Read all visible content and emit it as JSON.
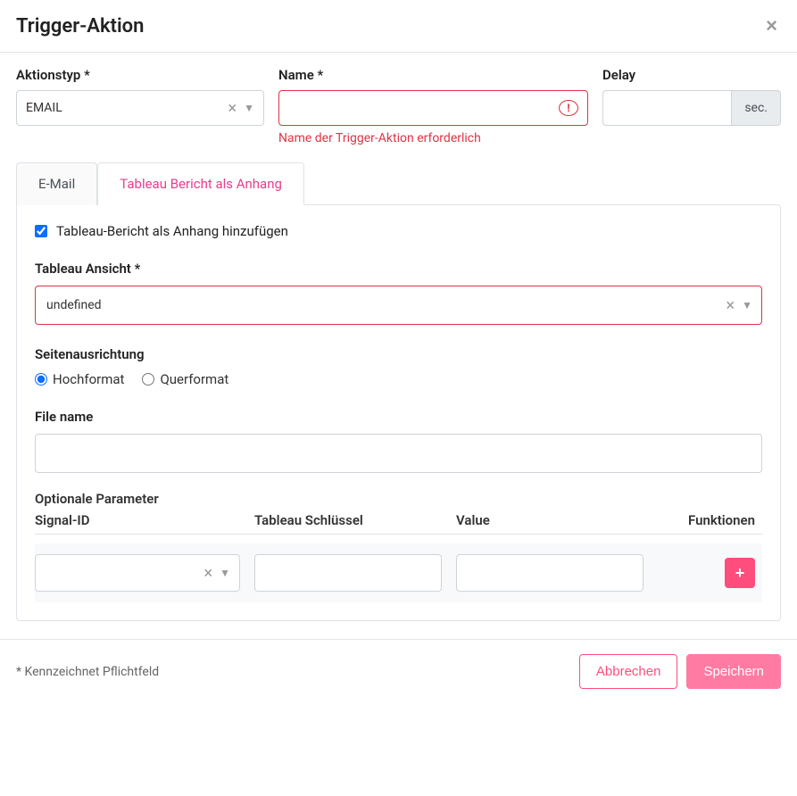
{
  "modal": {
    "title": "Trigger-Aktion"
  },
  "form": {
    "actionType": {
      "label": "Aktionstyp *",
      "value": "EMAIL"
    },
    "name": {
      "label": "Name *",
      "value": "",
      "error": "Name der Trigger-Aktion erforderlich"
    },
    "delay": {
      "label": "Delay",
      "value": "",
      "unit": "sec."
    }
  },
  "tabs": {
    "email": "E-Mail",
    "tableau": "Tableau Bericht als Anhang"
  },
  "tableau": {
    "checkboxLabel": "Tableau-Bericht als Anhang hinzufügen",
    "checkboxChecked": true,
    "viewLabel": "Tableau Ansicht *",
    "viewValue": "undefined",
    "orientationLabel": "Seitenausrichtung",
    "orientation": {
      "portrait": "Hochformat",
      "landscape": "Querformat",
      "selected": "portrait"
    },
    "fileNameLabel": "File name",
    "fileNameValue": "",
    "params": {
      "sectionTitle": "Optionale Parameter",
      "cols": {
        "signal": "Signal-ID",
        "key": "Tableau Schlüssel",
        "value": "Value",
        "fn": "Funktionen"
      },
      "row": {
        "signal": "",
        "key": "",
        "value": ""
      }
    }
  },
  "footer": {
    "requiredNote": "* Kennzeichnet Pflichtfeld",
    "cancel": "Abbrechen",
    "save": "Speichern"
  }
}
